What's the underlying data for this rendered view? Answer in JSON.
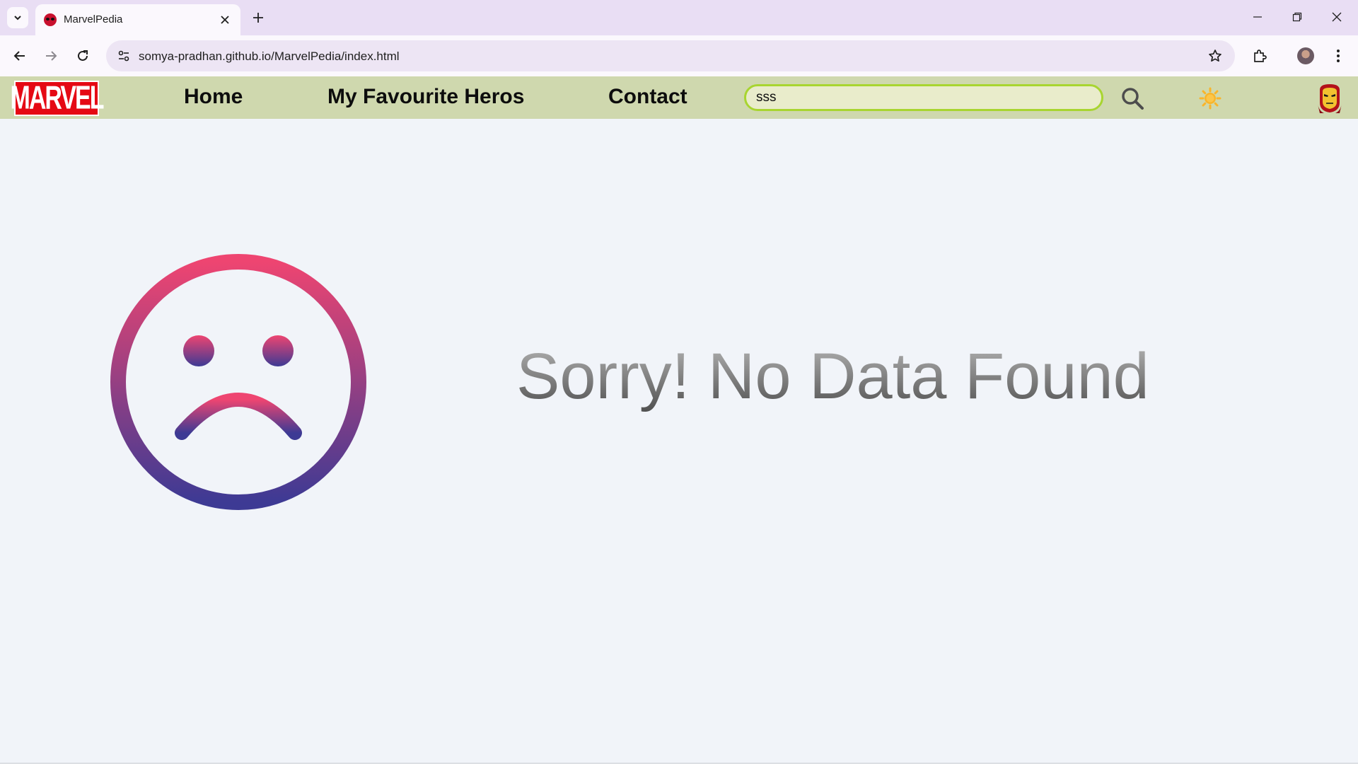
{
  "browser": {
    "tab_title": "MarvelPedia",
    "url": "somya-pradhan.github.io/MarvelPedia/index.html"
  },
  "site": {
    "logo_text": "MARVEL",
    "nav": {
      "home": "Home",
      "favourites": "My Favourite Heros",
      "contact": "Contact"
    },
    "search": {
      "value": "sss"
    },
    "message": "Sorry! No Data Found"
  },
  "colors": {
    "header_bg": "#cfd8ae",
    "search_border": "#a8d530",
    "logo_red": "#e50914",
    "sad_face_top": "#ee4571",
    "sad_face_bottom": "#3d3a94",
    "sun_icon": "#f9b52b"
  },
  "icons": {
    "search": "magnifier-icon",
    "theme": "sun-icon",
    "avatar": "iron-man-icon",
    "empty_state": "sad-face-icon"
  }
}
